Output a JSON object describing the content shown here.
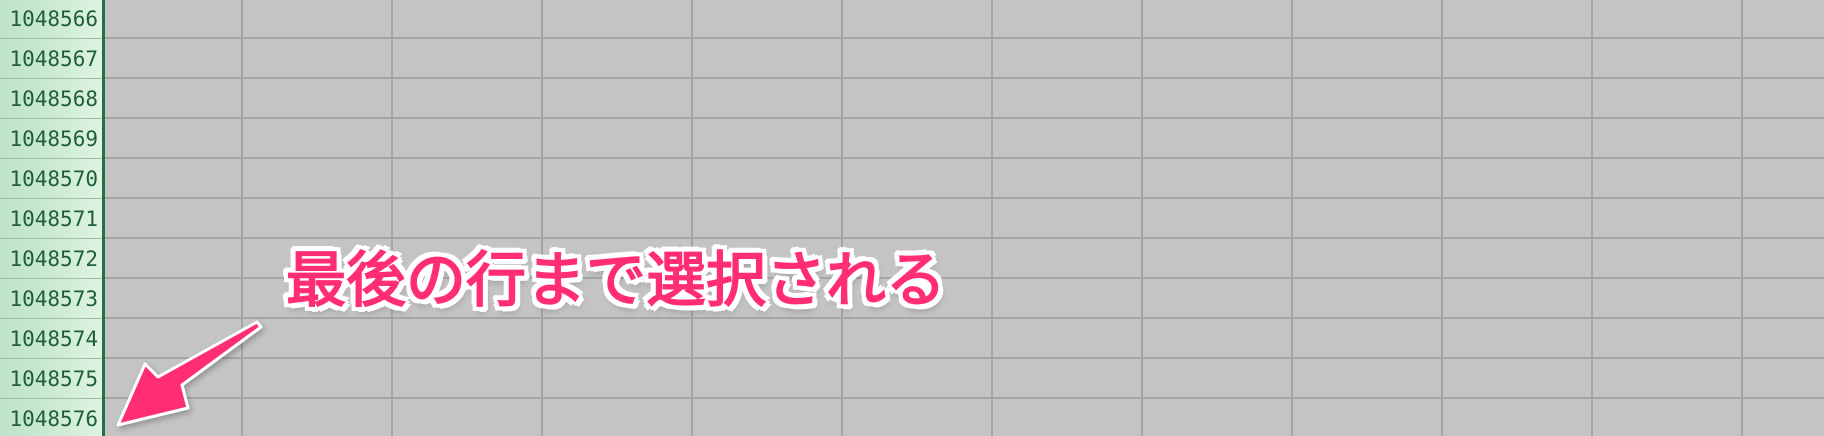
{
  "row_headers": [
    "1048566",
    "1048567",
    "1048568",
    "1048569",
    "1048570",
    "1048571",
    "1048572",
    "1048573",
    "1048574",
    "1048575",
    "1048576"
  ],
  "annotation": {
    "text": "最後の行まで選択される",
    "color": "#ff2d73",
    "arrow_icon": "arrow-down-left-icon"
  },
  "colors": {
    "selection_fill": "#c4c4c4",
    "gridline": "#a5a5a5",
    "row_header_highlight": "#c9e9cf",
    "row_header_text": "#1d5f38",
    "selection_border": "#217346"
  }
}
